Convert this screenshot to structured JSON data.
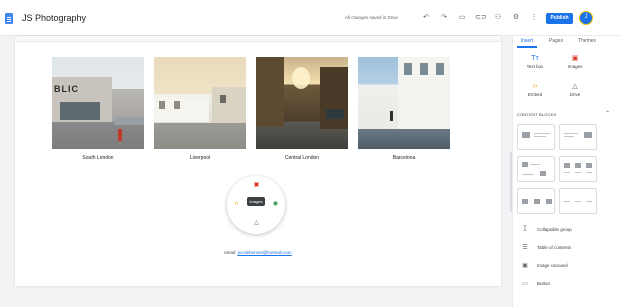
{
  "app": {
    "title": "JS Photography",
    "save_status": "All changes saved in Drive",
    "publish_label": "Publish",
    "avatar_initial": "J"
  },
  "toolbar_icons": [
    "undo-icon",
    "redo-icon",
    "preview-icon",
    "link-icon",
    "share-icon",
    "settings-icon",
    "more-icon"
  ],
  "gallery": [
    {
      "caption": "South London",
      "sign": "BLIC"
    },
    {
      "caption": "Liverpool"
    },
    {
      "caption": "Central London"
    },
    {
      "caption": "Barcelona"
    }
  ],
  "radial_menu": {
    "tooltip": "Images",
    "items": [
      "images-icon",
      "embed-icon",
      "drive-icon",
      "text-icon",
      "upload-icon"
    ]
  },
  "email": {
    "prefix": "email:",
    "address": "jscolebennet@hotmail.com"
  },
  "panel": {
    "tabs": [
      "Insert",
      "Pages",
      "Themes"
    ],
    "active_tab": "Insert",
    "insert_items": [
      {
        "label": "Text box",
        "icon": "text-box-icon"
      },
      {
        "label": "Images",
        "icon": "image-icon"
      },
      {
        "label": "Embed",
        "icon": "embed-icon"
      },
      {
        "label": "Drive",
        "icon": "drive-icon"
      }
    ],
    "content_blocks_title": "CONTENT BLOCKS",
    "list_items": [
      {
        "label": "Collapsible group",
        "icon": "collapsible-group-icon"
      },
      {
        "label": "Table of contents",
        "icon": "table-of-contents-icon"
      },
      {
        "label": "Image carousel",
        "icon": "image-carousel-icon"
      },
      {
        "label": "Button",
        "icon": "button-icon"
      }
    ]
  },
  "colors": {
    "accent": "#1a73e8",
    "insert_icon_red": "#d93025",
    "embed_orange": "#f29900",
    "upload_green": "#1e8e3e"
  }
}
